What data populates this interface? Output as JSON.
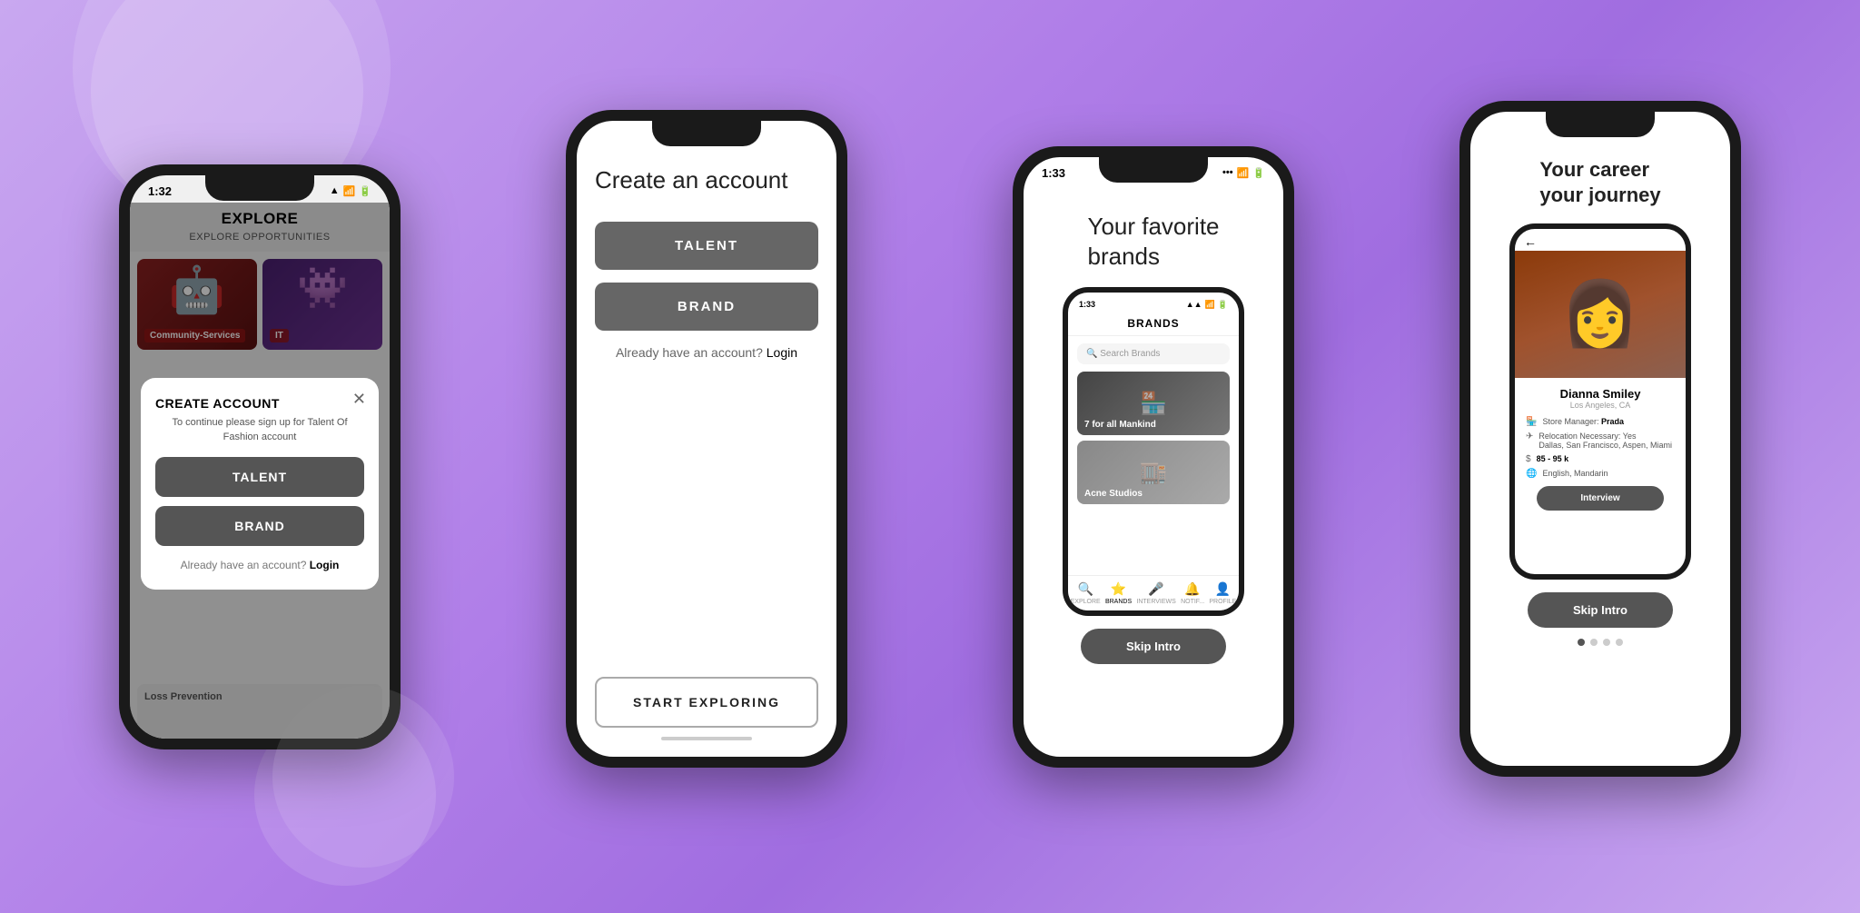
{
  "background": {
    "color": "#b07ee8"
  },
  "phone1": {
    "status_time": "1:32",
    "header_title": "EXPLORE",
    "header_sub": "EXPLORE OPPORTUNITIES",
    "card1_label": "Community-Services",
    "card2_label": "IT",
    "modal": {
      "title": "CREATE ACCOUNT",
      "subtitle": "To continue please sign up for Talent Of Fashion account",
      "close_icon": "✕",
      "talent_btn": "TALENT",
      "brand_btn": "BRAND",
      "account_text": "Already have an account?",
      "login_link": "Login"
    },
    "loss_prevention_label": "Loss Prevention"
  },
  "phone2": {
    "title": "Create an account",
    "talent_btn": "TALENT",
    "brand_btn": "BRAND",
    "account_text": "Already have an account?",
    "login_link": "Login",
    "start_btn": "START EXPLORING"
  },
  "phone3": {
    "status_time": "1:33",
    "hero_title_line1": "Your favorite",
    "hero_title_line2": "brands",
    "inner_screen": {
      "header": "BRANDS",
      "search_placeholder": "Search Brands",
      "brand1_label": "7 for all Mankind",
      "brand2_label": "Acne Studios",
      "nav_items": [
        "EXPLORE",
        "BRANDS",
        "INTERVIEWS",
        "NOTIFICATIONS",
        "PROFILE"
      ]
    },
    "skip_intro_btn": "Skip Intro"
  },
  "phone4": {
    "hero_title_line1": "Your career",
    "hero_title_line2": "your journey",
    "profile": {
      "name": "Dianna Smiley",
      "location": "Los Angeles, CA",
      "role_label": "Store Manager:",
      "role_value": "Prada",
      "relocation_label": "Relocation Necessary:",
      "relocation_value": "Yes",
      "relocation_cities": "Dallas, San Francisco, Aspen, Miami",
      "salary_label": "85 - 95 k",
      "languages_label": "English, Mandarin",
      "interview_btn": "Interview",
      "back_icon": "←"
    },
    "skip_intro_btn": "Skip Intro",
    "dots": [
      true,
      false,
      false,
      false
    ]
  }
}
